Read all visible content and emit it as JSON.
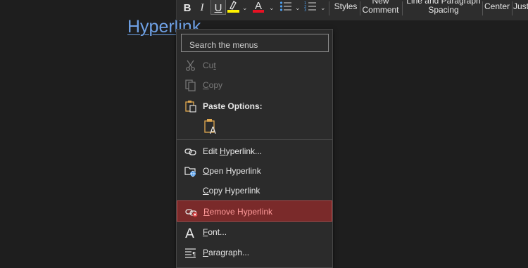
{
  "document": {
    "link_text": "Hyperlink"
  },
  "toolbar": {
    "bold": "B",
    "italic": "I",
    "underline": "U",
    "font_color_glyph": "A",
    "highlight_color": "#fff200",
    "font_color": "#e81123",
    "styles": "Styles",
    "new_comment_line1": "New",
    "new_comment_line2": "Comment",
    "line_spacing_line1": "Line and Paragraph",
    "line_spacing_line2": "Spacing",
    "center": "Center",
    "justify": "Just"
  },
  "menu": {
    "search_placeholder": "Search the menus",
    "items": [
      {
        "pre": "Cu",
        "key": "t",
        "post": "",
        "icon": "scissors-icon",
        "disabled": true
      },
      {
        "pre": "",
        "key": "C",
        "post": "opy",
        "icon": "copy-icon",
        "disabled": true
      },
      {
        "label": "Paste Options:",
        "icon": "clipboard-icon"
      },
      {
        "pre": "Edit ",
        "key": "H",
        "post": "yperlink...",
        "icon": "link-icon"
      },
      {
        "pre": "",
        "key": "O",
        "post": "pen Hyperlink",
        "icon": "open-link-icon"
      },
      {
        "pre": "",
        "key": "C",
        "post": "opy Hyperlink"
      },
      {
        "pre": "",
        "key": "R",
        "post": "emove Hyperlink",
        "icon": "remove-link-icon",
        "highlight": true
      },
      {
        "pre": "",
        "key": "F",
        "post": "ont...",
        "icon": "font-icon"
      },
      {
        "pre": "",
        "key": "P",
        "post": "aragraph...",
        "icon": "paragraph-icon"
      }
    ],
    "highlight_color": "#7a2a2a"
  }
}
